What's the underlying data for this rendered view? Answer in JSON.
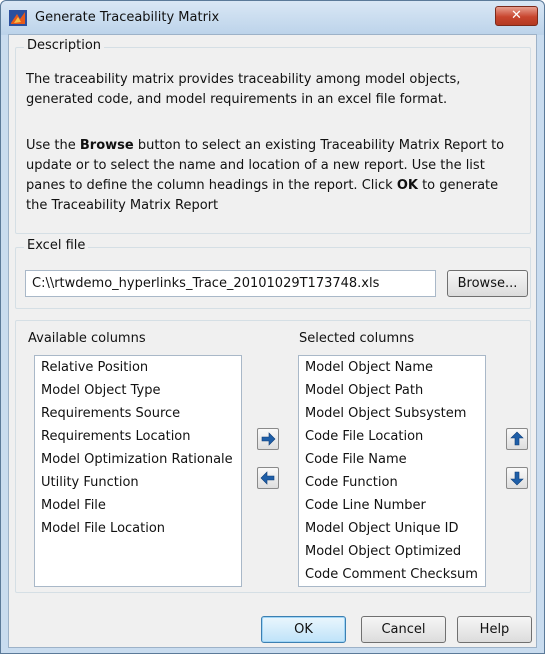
{
  "window": {
    "title": "Generate Traceability Matrix",
    "close_label": "✕"
  },
  "description": {
    "group_title": "Description",
    "para1_line1": "The traceability matrix provides traceability among model objects,",
    "para1_line2": "generated code, and model requirements in an excel file format.",
    "para2_line1_pre": "Use the ",
    "para2_line1_bold": "Browse",
    "para2_line1_post": " button to select an existing Traceability Matrix Report to",
    "para2_line2": "update or to select the name and location of a new report. Use the list",
    "para2_line3_pre": "panes to define the column headings in the report. Click ",
    "para2_line3_bold": "OK",
    "para2_line3_post": " to generate",
    "para2_line4": "the Traceability Matrix Report"
  },
  "excel": {
    "group_title": "Excel file",
    "path_value": "C:\\\\rtwdemo_hyperlinks_Trace_20101029T173748.xls",
    "browse_label": "Browse..."
  },
  "available": {
    "label": "Available columns",
    "items": [
      "Relative Position",
      "Model Object Type",
      "Requirements Source",
      "Requirements Location",
      "Model Optimization Rationale",
      "Utility Function",
      "Model File",
      "Model File Location"
    ]
  },
  "selected": {
    "label": "Selected columns",
    "items": [
      "Model Object Name",
      "Model Object Path",
      "Model Object Subsystem",
      "Code File Location",
      "Code File Name",
      "Code Function",
      "Code Line Number",
      "Model Object Unique ID",
      "Model Object Optimized",
      "Code Comment Checksum"
    ]
  },
  "icons": {
    "move_right": "arrow-right-icon",
    "move_left": "arrow-left-icon",
    "move_up": "arrow-up-icon",
    "move_down": "arrow-down-icon",
    "arrow_color": "#1f5fa8"
  },
  "footer": {
    "ok_label": "OK",
    "cancel_label": "Cancel",
    "help_label": "Help"
  }
}
